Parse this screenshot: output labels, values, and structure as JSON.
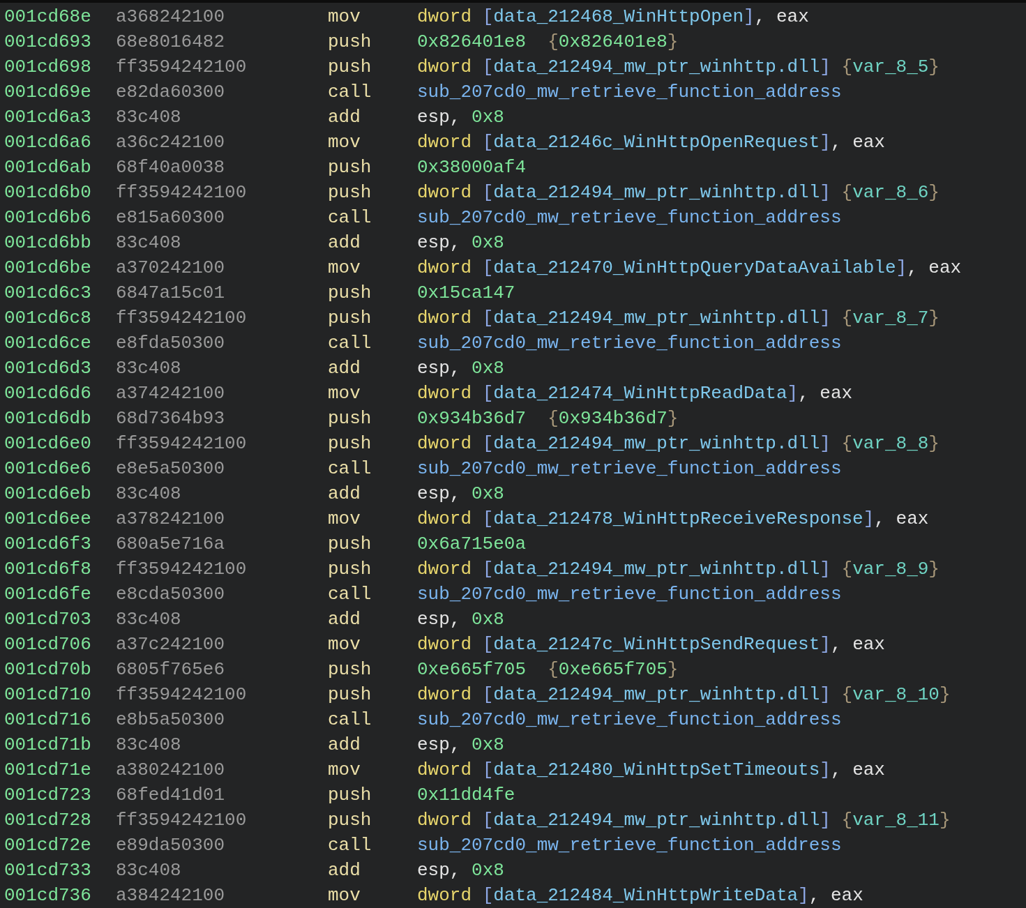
{
  "listing": [
    {
      "address": "001cd68e",
      "bytes": "a368242100",
      "mnemonic": "mov",
      "operand": [
        {
          "kind": "size",
          "text": "dword "
        },
        {
          "kind": "bracket",
          "text": "["
        },
        {
          "kind": "symbol",
          "text": "data_212468_WinHttpOpen"
        },
        {
          "kind": "bracket",
          "text": "]"
        },
        {
          "kind": "punct",
          "text": ", "
        },
        {
          "kind": "register",
          "text": "eax"
        }
      ]
    },
    {
      "address": "001cd693",
      "bytes": "68e8016482",
      "mnemonic": "push",
      "operand": [
        {
          "kind": "number",
          "text": "0x826401e8"
        },
        {
          "kind": "space"
        },
        {
          "kind": "space"
        },
        {
          "kind": "brace",
          "text": "{"
        },
        {
          "kind": "number",
          "text": "0x826401e8"
        },
        {
          "kind": "brace",
          "text": "}"
        }
      ]
    },
    {
      "address": "001cd698",
      "bytes": "ff3594242100",
      "mnemonic": "push",
      "operand": [
        {
          "kind": "size",
          "text": "dword "
        },
        {
          "kind": "bracket",
          "text": "["
        },
        {
          "kind": "symbol",
          "text": "data_212494_mw_ptr_winhttp.dll"
        },
        {
          "kind": "bracket",
          "text": "]"
        },
        {
          "kind": "space"
        },
        {
          "kind": "brace",
          "text": "{"
        },
        {
          "kind": "variable",
          "text": "var_8_5"
        },
        {
          "kind": "brace",
          "text": "}"
        }
      ]
    },
    {
      "address": "001cd69e",
      "bytes": "e82da60300",
      "mnemonic": "call",
      "operand": [
        {
          "kind": "function",
          "text": "sub_207cd0_mw_retrieve_function_address"
        }
      ]
    },
    {
      "address": "001cd6a3",
      "bytes": "83c408",
      "mnemonic": "add",
      "operand": [
        {
          "kind": "register",
          "text": "esp"
        },
        {
          "kind": "punct",
          "text": ", "
        },
        {
          "kind": "number",
          "text": "0x8"
        }
      ]
    },
    {
      "address": "001cd6a6",
      "bytes": "a36c242100",
      "mnemonic": "mov",
      "operand": [
        {
          "kind": "size",
          "text": "dword "
        },
        {
          "kind": "bracket",
          "text": "["
        },
        {
          "kind": "symbol",
          "text": "data_21246c_WinHttpOpenRequest"
        },
        {
          "kind": "bracket",
          "text": "]"
        },
        {
          "kind": "punct",
          "text": ", "
        },
        {
          "kind": "register",
          "text": "eax"
        }
      ]
    },
    {
      "address": "001cd6ab",
      "bytes": "68f40a0038",
      "mnemonic": "push",
      "operand": [
        {
          "kind": "number",
          "text": "0x38000af4"
        }
      ]
    },
    {
      "address": "001cd6b0",
      "bytes": "ff3594242100",
      "mnemonic": "push",
      "operand": [
        {
          "kind": "size",
          "text": "dword "
        },
        {
          "kind": "bracket",
          "text": "["
        },
        {
          "kind": "symbol",
          "text": "data_212494_mw_ptr_winhttp.dll"
        },
        {
          "kind": "bracket",
          "text": "]"
        },
        {
          "kind": "space"
        },
        {
          "kind": "brace",
          "text": "{"
        },
        {
          "kind": "variable",
          "text": "var_8_6"
        },
        {
          "kind": "brace",
          "text": "}"
        }
      ]
    },
    {
      "address": "001cd6b6",
      "bytes": "e815a60300",
      "mnemonic": "call",
      "operand": [
        {
          "kind": "function",
          "text": "sub_207cd0_mw_retrieve_function_address"
        }
      ]
    },
    {
      "address": "001cd6bb",
      "bytes": "83c408",
      "mnemonic": "add",
      "operand": [
        {
          "kind": "register",
          "text": "esp"
        },
        {
          "kind": "punct",
          "text": ", "
        },
        {
          "kind": "number",
          "text": "0x8"
        }
      ]
    },
    {
      "address": "001cd6be",
      "bytes": "a370242100",
      "mnemonic": "mov",
      "operand": [
        {
          "kind": "size",
          "text": "dword "
        },
        {
          "kind": "bracket",
          "text": "["
        },
        {
          "kind": "symbol",
          "text": "data_212470_WinHttpQueryDataAvailable"
        },
        {
          "kind": "bracket",
          "text": "]"
        },
        {
          "kind": "punct",
          "text": ", "
        },
        {
          "kind": "register",
          "text": "eax"
        }
      ]
    },
    {
      "address": "001cd6c3",
      "bytes": "6847a15c01",
      "mnemonic": "push",
      "operand": [
        {
          "kind": "number",
          "text": "0x15ca147"
        }
      ]
    },
    {
      "address": "001cd6c8",
      "bytes": "ff3594242100",
      "mnemonic": "push",
      "operand": [
        {
          "kind": "size",
          "text": "dword "
        },
        {
          "kind": "bracket",
          "text": "["
        },
        {
          "kind": "symbol",
          "text": "data_212494_mw_ptr_winhttp.dll"
        },
        {
          "kind": "bracket",
          "text": "]"
        },
        {
          "kind": "space"
        },
        {
          "kind": "brace",
          "text": "{"
        },
        {
          "kind": "variable",
          "text": "var_8_7"
        },
        {
          "kind": "brace",
          "text": "}"
        }
      ]
    },
    {
      "address": "001cd6ce",
      "bytes": "e8fda50300",
      "mnemonic": "call",
      "operand": [
        {
          "kind": "function",
          "text": "sub_207cd0_mw_retrieve_function_address"
        }
      ]
    },
    {
      "address": "001cd6d3",
      "bytes": "83c408",
      "mnemonic": "add",
      "operand": [
        {
          "kind": "register",
          "text": "esp"
        },
        {
          "kind": "punct",
          "text": ", "
        },
        {
          "kind": "number",
          "text": "0x8"
        }
      ]
    },
    {
      "address": "001cd6d6",
      "bytes": "a374242100",
      "mnemonic": "mov",
      "operand": [
        {
          "kind": "size",
          "text": "dword "
        },
        {
          "kind": "bracket",
          "text": "["
        },
        {
          "kind": "symbol",
          "text": "data_212474_WinHttpReadData"
        },
        {
          "kind": "bracket",
          "text": "]"
        },
        {
          "kind": "punct",
          "text": ", "
        },
        {
          "kind": "register",
          "text": "eax"
        }
      ]
    },
    {
      "address": "001cd6db",
      "bytes": "68d7364b93",
      "mnemonic": "push",
      "operand": [
        {
          "kind": "number",
          "text": "0x934b36d7"
        },
        {
          "kind": "space"
        },
        {
          "kind": "space"
        },
        {
          "kind": "brace",
          "text": "{"
        },
        {
          "kind": "number",
          "text": "0x934b36d7"
        },
        {
          "kind": "brace",
          "text": "}"
        }
      ]
    },
    {
      "address": "001cd6e0",
      "bytes": "ff3594242100",
      "mnemonic": "push",
      "operand": [
        {
          "kind": "size",
          "text": "dword "
        },
        {
          "kind": "bracket",
          "text": "["
        },
        {
          "kind": "symbol",
          "text": "data_212494_mw_ptr_winhttp.dll"
        },
        {
          "kind": "bracket",
          "text": "]"
        },
        {
          "kind": "space"
        },
        {
          "kind": "brace",
          "text": "{"
        },
        {
          "kind": "variable",
          "text": "var_8_8"
        },
        {
          "kind": "brace",
          "text": "}"
        }
      ]
    },
    {
      "address": "001cd6e6",
      "bytes": "e8e5a50300",
      "mnemonic": "call",
      "operand": [
        {
          "kind": "function",
          "text": "sub_207cd0_mw_retrieve_function_address"
        }
      ]
    },
    {
      "address": "001cd6eb",
      "bytes": "83c408",
      "mnemonic": "add",
      "operand": [
        {
          "kind": "register",
          "text": "esp"
        },
        {
          "kind": "punct",
          "text": ", "
        },
        {
          "kind": "number",
          "text": "0x8"
        }
      ]
    },
    {
      "address": "001cd6ee",
      "bytes": "a378242100",
      "mnemonic": "mov",
      "operand": [
        {
          "kind": "size",
          "text": "dword "
        },
        {
          "kind": "bracket",
          "text": "["
        },
        {
          "kind": "symbol",
          "text": "data_212478_WinHttpReceiveResponse"
        },
        {
          "kind": "bracket",
          "text": "]"
        },
        {
          "kind": "punct",
          "text": ", "
        },
        {
          "kind": "register",
          "text": "eax"
        }
      ]
    },
    {
      "address": "001cd6f3",
      "bytes": "680a5e716a",
      "mnemonic": "push",
      "operand": [
        {
          "kind": "number",
          "text": "0x6a715e0a"
        }
      ]
    },
    {
      "address": "001cd6f8",
      "bytes": "ff3594242100",
      "mnemonic": "push",
      "operand": [
        {
          "kind": "size",
          "text": "dword "
        },
        {
          "kind": "bracket",
          "text": "["
        },
        {
          "kind": "symbol",
          "text": "data_212494_mw_ptr_winhttp.dll"
        },
        {
          "kind": "bracket",
          "text": "]"
        },
        {
          "kind": "space"
        },
        {
          "kind": "brace",
          "text": "{"
        },
        {
          "kind": "variable",
          "text": "var_8_9"
        },
        {
          "kind": "brace",
          "text": "}"
        }
      ]
    },
    {
      "address": "001cd6fe",
      "bytes": "e8cda50300",
      "mnemonic": "call",
      "operand": [
        {
          "kind": "function",
          "text": "sub_207cd0_mw_retrieve_function_address"
        }
      ]
    },
    {
      "address": "001cd703",
      "bytes": "83c408",
      "mnemonic": "add",
      "operand": [
        {
          "kind": "register",
          "text": "esp"
        },
        {
          "kind": "punct",
          "text": ", "
        },
        {
          "kind": "number",
          "text": "0x8"
        }
      ]
    },
    {
      "address": "001cd706",
      "bytes": "a37c242100",
      "mnemonic": "mov",
      "operand": [
        {
          "kind": "size",
          "text": "dword "
        },
        {
          "kind": "bracket",
          "text": "["
        },
        {
          "kind": "symbol",
          "text": "data_21247c_WinHttpSendRequest"
        },
        {
          "kind": "bracket",
          "text": "]"
        },
        {
          "kind": "punct",
          "text": ", "
        },
        {
          "kind": "register",
          "text": "eax"
        }
      ]
    },
    {
      "address": "001cd70b",
      "bytes": "6805f765e6",
      "mnemonic": "push",
      "operand": [
        {
          "kind": "number",
          "text": "0xe665f705"
        },
        {
          "kind": "space"
        },
        {
          "kind": "space"
        },
        {
          "kind": "brace",
          "text": "{"
        },
        {
          "kind": "number",
          "text": "0xe665f705"
        },
        {
          "kind": "brace",
          "text": "}"
        }
      ]
    },
    {
      "address": "001cd710",
      "bytes": "ff3594242100",
      "mnemonic": "push",
      "operand": [
        {
          "kind": "size",
          "text": "dword "
        },
        {
          "kind": "bracket",
          "text": "["
        },
        {
          "kind": "symbol",
          "text": "data_212494_mw_ptr_winhttp.dll"
        },
        {
          "kind": "bracket",
          "text": "]"
        },
        {
          "kind": "space"
        },
        {
          "kind": "brace",
          "text": "{"
        },
        {
          "kind": "variable",
          "text": "var_8_10"
        },
        {
          "kind": "brace",
          "text": "}"
        }
      ]
    },
    {
      "address": "001cd716",
      "bytes": "e8b5a50300",
      "mnemonic": "call",
      "operand": [
        {
          "kind": "function",
          "text": "sub_207cd0_mw_retrieve_function_address"
        }
      ]
    },
    {
      "address": "001cd71b",
      "bytes": "83c408",
      "mnemonic": "add",
      "operand": [
        {
          "kind": "register",
          "text": "esp"
        },
        {
          "kind": "punct",
          "text": ", "
        },
        {
          "kind": "number",
          "text": "0x8"
        }
      ]
    },
    {
      "address": "001cd71e",
      "bytes": "a380242100",
      "mnemonic": "mov",
      "operand": [
        {
          "kind": "size",
          "text": "dword "
        },
        {
          "kind": "bracket",
          "text": "["
        },
        {
          "kind": "symbol",
          "text": "data_212480_WinHttpSetTimeouts"
        },
        {
          "kind": "bracket",
          "text": "]"
        },
        {
          "kind": "punct",
          "text": ", "
        },
        {
          "kind": "register",
          "text": "eax"
        }
      ]
    },
    {
      "address": "001cd723",
      "bytes": "68fed41d01",
      "mnemonic": "push",
      "operand": [
        {
          "kind": "number",
          "text": "0x11dd4fe"
        }
      ]
    },
    {
      "address": "001cd728",
      "bytes": "ff3594242100",
      "mnemonic": "push",
      "operand": [
        {
          "kind": "size",
          "text": "dword "
        },
        {
          "kind": "bracket",
          "text": "["
        },
        {
          "kind": "symbol",
          "text": "data_212494_mw_ptr_winhttp.dll"
        },
        {
          "kind": "bracket",
          "text": "]"
        },
        {
          "kind": "space"
        },
        {
          "kind": "brace",
          "text": "{"
        },
        {
          "kind": "variable",
          "text": "var_8_11"
        },
        {
          "kind": "brace",
          "text": "}"
        }
      ]
    },
    {
      "address": "001cd72e",
      "bytes": "e89da50300",
      "mnemonic": "call",
      "operand": [
        {
          "kind": "function",
          "text": "sub_207cd0_mw_retrieve_function_address"
        }
      ]
    },
    {
      "address": "001cd733",
      "bytes": "83c408",
      "mnemonic": "add",
      "operand": [
        {
          "kind": "register",
          "text": "esp"
        },
        {
          "kind": "punct",
          "text": ", "
        },
        {
          "kind": "number",
          "text": "0x8"
        }
      ]
    },
    {
      "address": "001cd736",
      "bytes": "a384242100",
      "mnemonic": "mov",
      "operand": [
        {
          "kind": "size",
          "text": "dword "
        },
        {
          "kind": "bracket",
          "text": "["
        },
        {
          "kind": "symbol",
          "text": "data_212484_WinHttpWriteData"
        },
        {
          "kind": "bracket",
          "text": "]"
        },
        {
          "kind": "punct",
          "text": ", "
        },
        {
          "kind": "register",
          "text": "eax"
        }
      ]
    }
  ]
}
